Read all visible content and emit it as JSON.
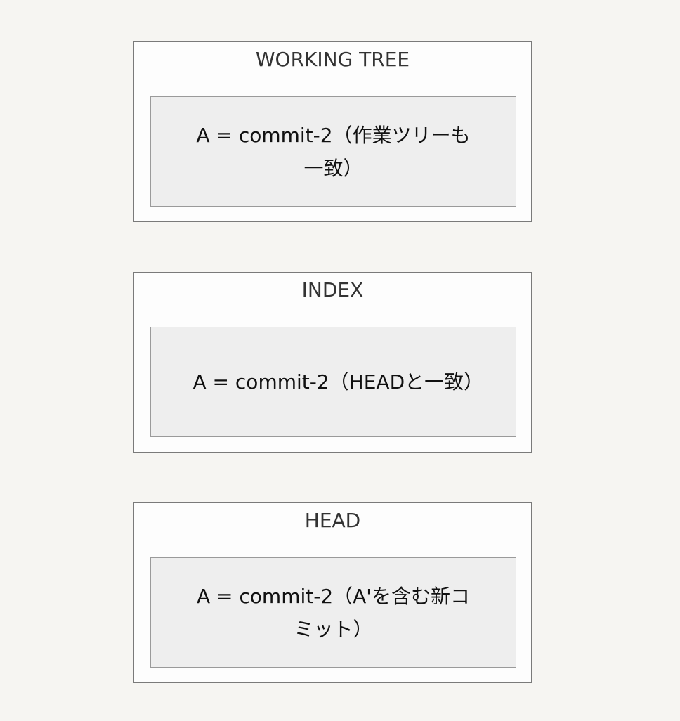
{
  "panels": [
    {
      "title": "WORKING TREE",
      "content": "A = commit-2（作業ツリーも一致）"
    },
    {
      "title": "INDEX",
      "content": "A = commit-2（HEADと一致）"
    },
    {
      "title": "HEAD",
      "content": "A = commit-2（A'を含む新コミット）"
    }
  ]
}
